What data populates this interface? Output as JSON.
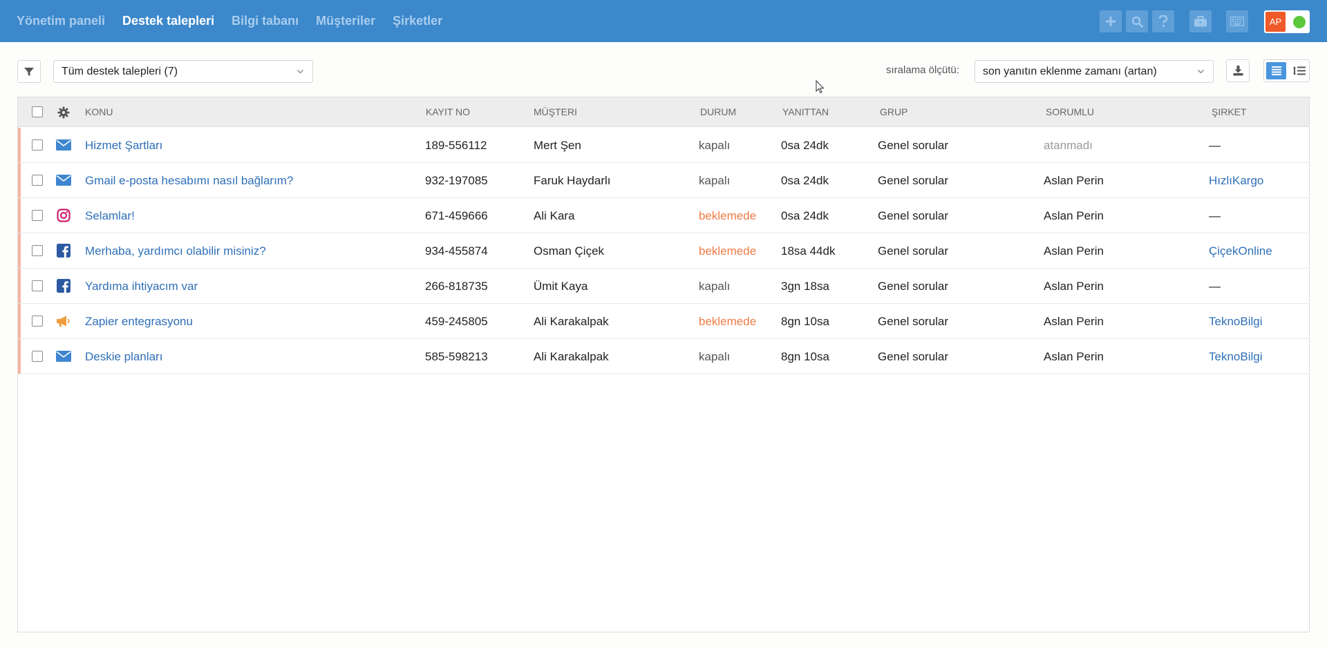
{
  "nav": {
    "items": [
      {
        "label": "Yönetim paneli",
        "active": false
      },
      {
        "label": "Destek talepleri",
        "active": true
      },
      {
        "label": "Bilgi tabanı",
        "active": false
      },
      {
        "label": "Müşteriler",
        "active": false
      },
      {
        "label": "Şirketler",
        "active": false
      }
    ]
  },
  "topbar": {
    "icons": [
      "plus-icon",
      "search-icon",
      "question-icon",
      "briefcase-icon",
      "keyboard-icon"
    ],
    "user_initials": "AP",
    "status_color": "#5cc83c"
  },
  "toolbar": {
    "view_select_value": "Tüm destek talepleri (7)",
    "sort_label": "sıralama ölçütü:",
    "sort_select_value": "son yanıtın eklenme zamanı (artan)"
  },
  "table": {
    "columns": [
      "Konu",
      "Kayıt No",
      "Müşteri",
      "Durum",
      "Yanıttan",
      "Grup",
      "Sorumlu",
      "Şirket"
    ],
    "rows": [
      {
        "channel": "email",
        "subject": "Hizmet Şartları",
        "id": "189-556112",
        "customer": "Mert Şen",
        "status": "kapalı",
        "status_type": "closed",
        "since": "0sa 24dk",
        "group": "Genel sorular",
        "assignee": "atanmadı",
        "assignee_unassigned": true,
        "company": "—",
        "company_link": false
      },
      {
        "channel": "email",
        "subject": "Gmail e-posta hesabımı nasıl bağlarım?",
        "id": "932-197085",
        "customer": "Faruk Haydarlı",
        "status": "kapalı",
        "status_type": "closed",
        "since": "0sa 24dk",
        "group": "Genel sorular",
        "assignee": "Aslan Perin",
        "assignee_unassigned": false,
        "company": "HızlıKargo",
        "company_link": true
      },
      {
        "channel": "instagram",
        "subject": "Selamlar!",
        "id": "671-459666",
        "customer": "Ali Kara",
        "status": "beklemede",
        "status_type": "pending",
        "since": "0sa 24dk",
        "group": "Genel sorular",
        "assignee": "Aslan Perin",
        "assignee_unassigned": false,
        "company": "—",
        "company_link": false
      },
      {
        "channel": "facebook",
        "subject": "Merhaba, yardımcı olabilir misiniz?",
        "id": "934-455874",
        "customer": "Osman Çiçek",
        "status": "beklemede",
        "status_type": "pending",
        "since": "18sa 44dk",
        "group": "Genel sorular",
        "assignee": "Aslan Perin",
        "assignee_unassigned": false,
        "company": "ÇiçekOnline",
        "company_link": true
      },
      {
        "channel": "facebook",
        "subject": "Yardıma ihtiyacım var",
        "id": "266-818735",
        "customer": "Ümit Kaya",
        "status": "kapalı",
        "status_type": "closed",
        "since": "3gn 18sa",
        "group": "Genel sorular",
        "assignee": "Aslan Perin",
        "assignee_unassigned": false,
        "company": "—",
        "company_link": false
      },
      {
        "channel": "megaphone",
        "subject": "Zapier entegrasyonu",
        "id": "459-245805",
        "customer": "Ali Karakalpak",
        "status": "beklemede",
        "status_type": "pending",
        "since": "8gn 10sa",
        "group": "Genel sorular",
        "assignee": "Aslan Perin",
        "assignee_unassigned": false,
        "company": "TeknoBilgi",
        "company_link": true
      },
      {
        "channel": "email",
        "subject": "Deskie planları",
        "id": "585-598213",
        "customer": "Ali Karakalpak",
        "status": "kapalı",
        "status_type": "closed",
        "since": "8gn 10sa",
        "group": "Genel sorular",
        "assignee": "Aslan Perin",
        "assignee_unassigned": false,
        "company": "TeknoBilgi",
        "company_link": true
      }
    ]
  },
  "colors": {
    "header_bg": "#3c88cb",
    "link": "#2f6fb7",
    "pending": "#ef7b45",
    "row_marker": "#f5b4a4"
  }
}
